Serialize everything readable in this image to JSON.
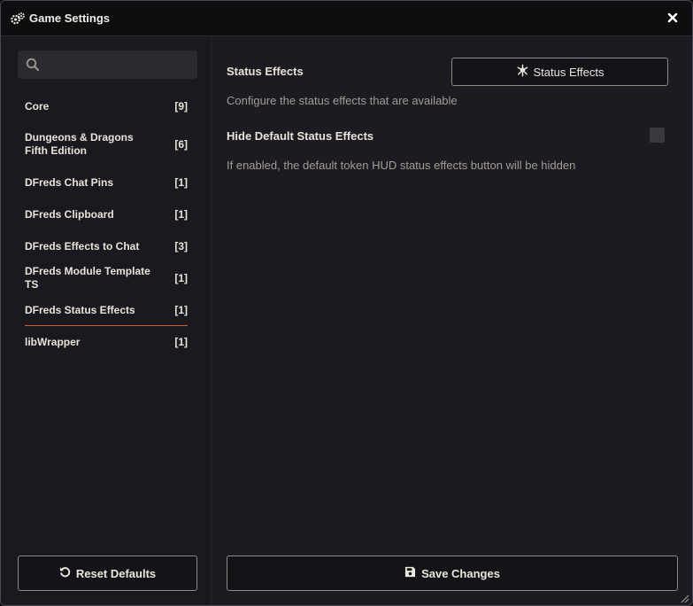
{
  "window": {
    "title": "Game Settings",
    "title_icon": "gears-icon",
    "close_icon": "close-icon"
  },
  "sidebar": {
    "search": {
      "value": "",
      "placeholder": "",
      "icon": "search-icon"
    },
    "categories": [
      {
        "name": "Core",
        "count": "[9]"
      },
      {
        "name": "Dungeons & Dragons Fifth Edition",
        "count": "[6]"
      },
      {
        "name": "DFreds Chat Pins",
        "count": "[1]"
      },
      {
        "name": "DFreds Clipboard",
        "count": "[1]"
      },
      {
        "name": "DFreds Effects to Chat",
        "count": "[3]"
      },
      {
        "name": "DFreds Module Template TS",
        "count": "[1]"
      },
      {
        "name": "DFreds Status Effects",
        "count": "[1]",
        "active": true
      },
      {
        "name": "libWrapper",
        "count": "[1]"
      }
    ],
    "reset_label": "Reset Defaults"
  },
  "main": {
    "status_effects": {
      "label": "Status Effects",
      "button_label": "Status Effects",
      "button_icon": "biohazard-icon",
      "hint": "Configure the status effects that are available"
    },
    "hide_default": {
      "label": "Hide Default Status Effects",
      "checked": false,
      "hint": "If enabled, the default token HUD status effects button will be hidden"
    },
    "save_label": "Save Changes"
  },
  "colors": {
    "background": "#1c1b22",
    "titlebar": "#0e0e10",
    "accent": "#c9593f",
    "border": "#8e8a82",
    "text": "#ebe3d8",
    "hint": "#a29c92"
  }
}
